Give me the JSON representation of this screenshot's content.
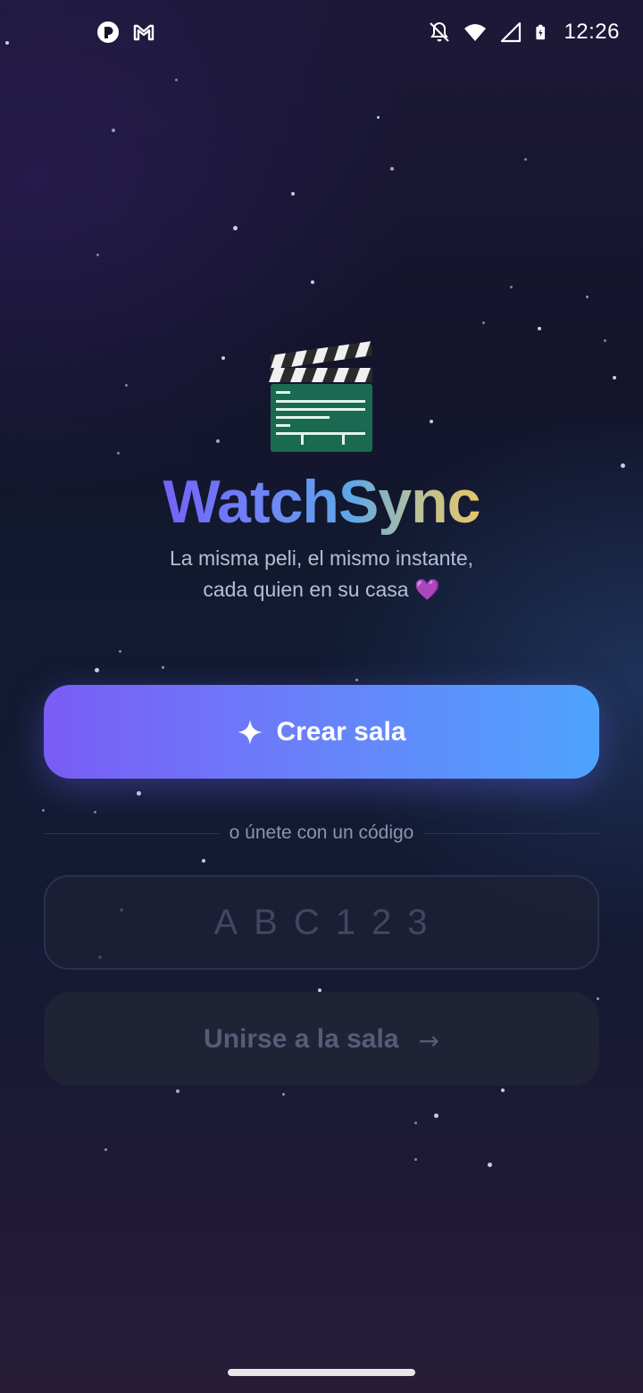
{
  "status_bar": {
    "time": "12:26",
    "left_icons": [
      "tap-app-icon",
      "gmail-icon"
    ],
    "right_icons": [
      "notifications-off-icon",
      "wifi-icon",
      "cellular-signal-icon",
      "battery-charging-icon"
    ]
  },
  "hero": {
    "icon": "clapperboard-icon",
    "title": "WatchSync",
    "tagline_line1": "La misma peli, el mismo instante,",
    "tagline_line2": "cada quien en su casa",
    "tagline_emoji": "💜"
  },
  "create_button": {
    "icon": "sparkle-icon",
    "label": "Crear sala"
  },
  "divider": {
    "label": "o únete con un código"
  },
  "code_input": {
    "value": "",
    "placeholder": "ABC123"
  },
  "join_button": {
    "label": "Unirse a la sala",
    "arrow": "→"
  },
  "colors": {
    "title_gradient": [
      "#7562f8",
      "#6b8ef5",
      "#5ea8e6",
      "#e6c567"
    ],
    "create_button_gradient": [
      "#7a5cf6",
      "#4ea3fd"
    ],
    "join_button_bg": "#202336",
    "background": "#14142c"
  }
}
